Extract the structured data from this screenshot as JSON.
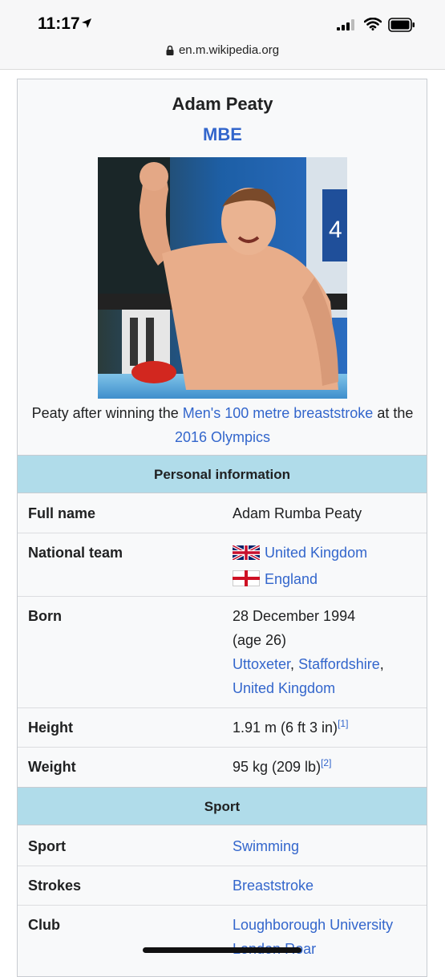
{
  "status": {
    "time": "11:17",
    "url": "en.m.wikipedia.org"
  },
  "infobox": {
    "name": "Adam Peaty",
    "honorific": "MBE",
    "caption_pre": "Peaty after winning the ",
    "caption_link1": "Men's 100 metre breaststroke",
    "caption_mid": " at the ",
    "caption_link2": "2016 Olympics",
    "sections": {
      "personal": "Personal information",
      "sport": "Sport"
    },
    "rows": {
      "full_name": {
        "label": "Full name",
        "value": "Adam Rumba Peaty"
      },
      "national_team": {
        "label": "National team",
        "value1": "United Kingdom",
        "value2": "England"
      },
      "born": {
        "label": "Born",
        "date": "28 December 1994",
        "age": "(age 26)",
        "place1": "Uttoxeter",
        "sep1": ", ",
        "place2": "Staffordshire",
        "sep2": ",",
        "place3": "United Kingdom"
      },
      "height": {
        "label": "Height",
        "value": "1.91 m (6 ft 3 in)",
        "ref": "[1]"
      },
      "weight": {
        "label": "Weight",
        "value": "95 kg (209 lb)",
        "ref": "[2]"
      },
      "sport": {
        "label": "Sport",
        "value": "Swimming"
      },
      "strokes": {
        "label": "Strokes",
        "value": "Breaststroke"
      },
      "club": {
        "label": "Club",
        "value1": "Loughborough University",
        "value2": "London Roar"
      }
    }
  },
  "colors": {
    "link": "#3366cc",
    "section_bg": "#b0dcea",
    "infobox_bg": "#f8f9fa"
  }
}
